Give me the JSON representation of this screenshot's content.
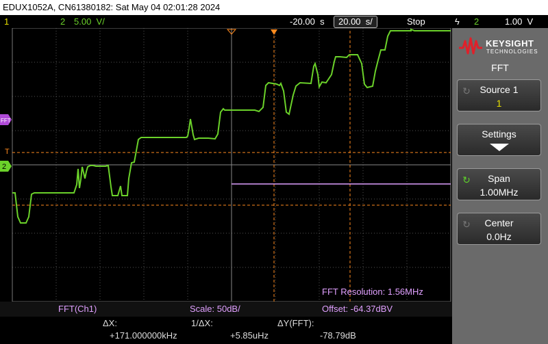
{
  "title_bar": "EDUX1052A, CN61380182: Sat May 04 02:01:28 2024",
  "status": {
    "ch1_number": "1",
    "ch2_number": "2",
    "ch2_scale": "5.00 V/",
    "delay": "-20.00 s",
    "timebase": "20.00 s/",
    "run_state": "Stop",
    "trigger_icon": "ϟ",
    "trigger_source": "2",
    "trigger_level": "1.00 V"
  },
  "markers": {
    "fft_label": "FFT",
    "trigger_marker": "T",
    "ch2_marker": "2"
  },
  "plot": {
    "fft_resolution": "FFT Resolution: 1.56MHz"
  },
  "bottom": {
    "fft_source": "FFT(Ch1)",
    "scale": "Scale: 50dB/",
    "offset": "Offset: -64.37dBV",
    "dx_label": "ΔX:",
    "dx_value": "+171.000000kHz",
    "inv_dx_label": "1/ΔX:",
    "inv_dx_value": "+5.85uHz",
    "dy_label": "ΔY(FFT):",
    "dy_value": "-78.79dB"
  },
  "side_panel": {
    "brand": "KEYSIGHT",
    "brand_sub": "TECHNOLOGIES",
    "menu_title": "FFT",
    "softkeys": [
      {
        "label": "Source 1",
        "value": "1"
      },
      {
        "label": "Settings",
        "value": ""
      },
      {
        "label": "Span",
        "value": "1.00MHz"
      },
      {
        "label": "Center",
        "value": "0.0Hz"
      }
    ]
  },
  "colors": {
    "ch1": "#e8e000",
    "ch2": "#6bd22a",
    "math": "#e0a0ff",
    "cursor": "#ff8a1e",
    "grid": "#555555"
  }
}
